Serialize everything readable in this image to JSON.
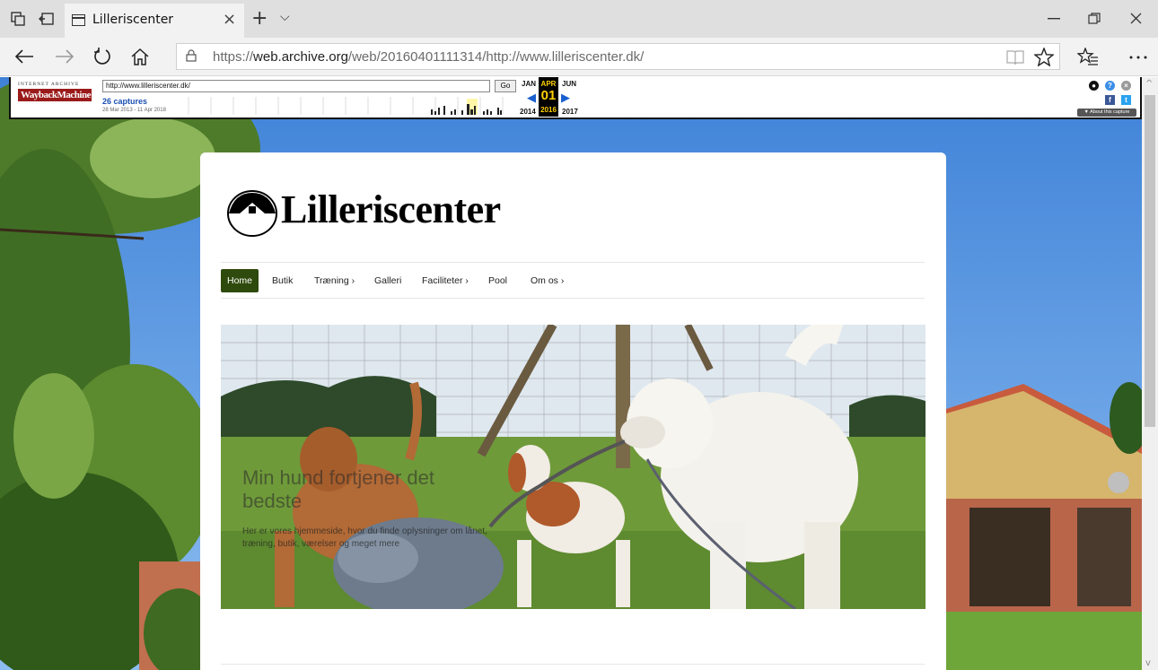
{
  "browser": {
    "tab_title": "Lilleriscenter",
    "tab_close": "×",
    "new_tab": "+",
    "tab_list": "⌵",
    "url_prefix": "https://",
    "url_host": "web.archive.org",
    "url_path": "/web/20160401111314/http://www.lilleriscenter.dk/",
    "icons": [
      "set-aside-tabs-icon",
      "restore-tabs-icon",
      "page-icon",
      "back-icon",
      "forward-icon",
      "refresh-icon",
      "home-icon",
      "lock-icon",
      "reading-view-icon",
      "favorite-star-icon",
      "favorites-hub-icon",
      "more-icon",
      "minimize-icon",
      "maximize-icon",
      "close-icon"
    ]
  },
  "wayback": {
    "logo_top": "INTERNET ARCHIVE",
    "logo_bottom": "WaybackMachine",
    "url_value": "http://www.lilleriscenter.dk/",
    "go_label": "Go",
    "captures": "26 captures",
    "range": "28 Mar 2013 - 11 Apr 2018",
    "prev_month": "JAN",
    "current_month": "APR",
    "next_month": "JUN",
    "current_day": "01",
    "prev_year": "2014",
    "current_year": "2016",
    "next_year": "2017",
    "about": "▼ About this capture",
    "colors": {
      "logo_red": "#9a1a1a",
      "capture_blue": "#1a4fb3",
      "current_bg": "#000000",
      "current_fg": "#ffd000"
    }
  },
  "site": {
    "logo_text": "Lilleriscenter",
    "nav": [
      "Home",
      "Butik",
      "Træning ›",
      "Galleri",
      "Faciliteter ›",
      "Pool",
      "Om os ›"
    ],
    "hero_heading": "Min hund fortjener det bedste",
    "hero_sub": "Her er vores hjemmeside, hvor du finde oplysninger om lånet, træning, butik, værelser og meget mere",
    "colors": {
      "nav_active": "#2e4a0c"
    }
  }
}
